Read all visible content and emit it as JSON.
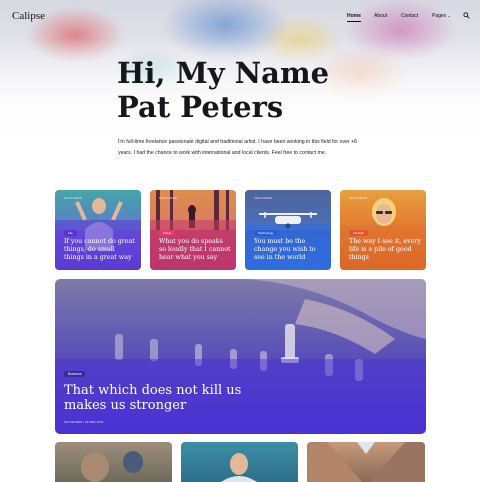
{
  "site": {
    "logo": "Calipse"
  },
  "nav": {
    "items": [
      {
        "label": "Home",
        "active": true
      },
      {
        "label": "About",
        "active": false
      },
      {
        "label": "Contact",
        "active": false
      },
      {
        "label": "Pages",
        "active": false,
        "has_dropdown": true
      }
    ],
    "search_icon": "search-icon"
  },
  "hero": {
    "title_line1": "Hi, My Name",
    "title_line2": "Pat Peters",
    "intro": "I'm full-time freelance passionate digital and traditional artist. I have been working in this field for over +6 years. I had the chance to work with international and local clients. Feel free to contact me."
  },
  "cards": [
    {
      "category": "FEATURED",
      "tag": "Life",
      "tag_color": "#5b2fd8",
      "title": "If you cannot do great things, do small things in a great way"
    },
    {
      "category": "FEATURED",
      "tag": "Travel",
      "tag_color": "#e23c6a",
      "title": "What you do speaks so loudly that I cannot hear what you say"
    },
    {
      "category": "FEATURED",
      "tag": "Technology",
      "tag_color": "#2d5ad8",
      "title": "You must be the change you wish to see in the world"
    },
    {
      "category": "FEATURED",
      "tag": "Lifestyle",
      "tag_color": "#e0552a",
      "title": "The way I see it, every life is a pile of good things"
    }
  ],
  "featured": {
    "tag": "Business",
    "title": "That which does not kill us makes us stronger",
    "meta": "PAT PETERS  •  19 MAR 2022"
  }
}
